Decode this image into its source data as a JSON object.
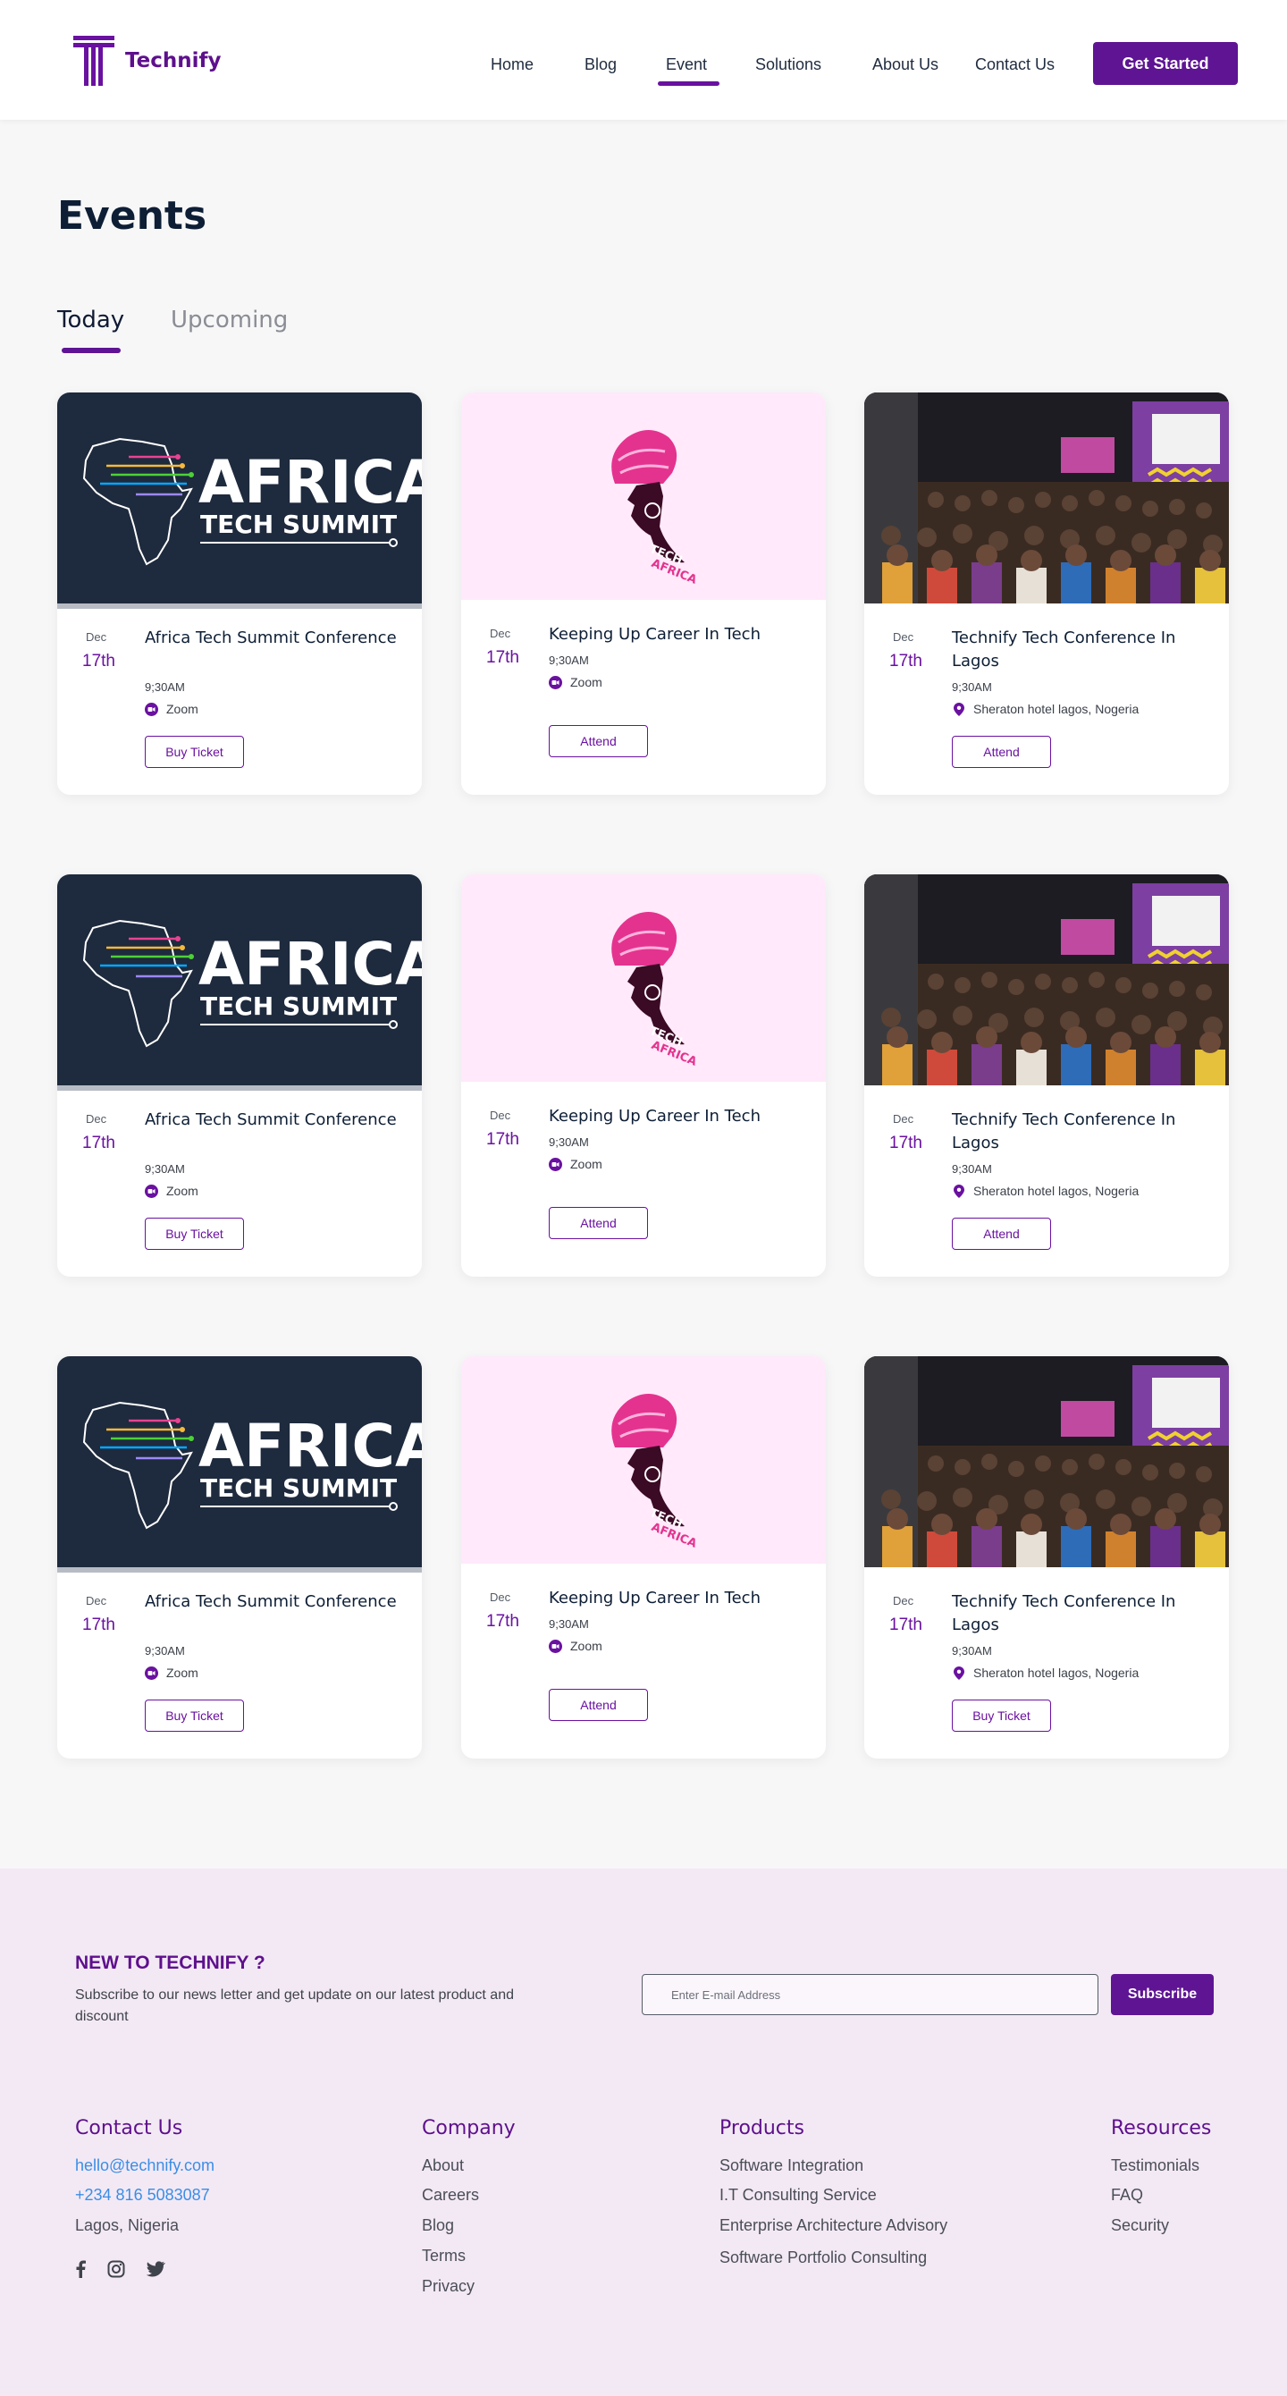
{
  "header": {
    "brand": "Technify",
    "nav": [
      {
        "label": "Home",
        "active": false
      },
      {
        "label": "Blog",
        "active": false
      },
      {
        "label": "Event",
        "active": true
      },
      {
        "label": "Solutions",
        "active": false
      },
      {
        "label": "About Us",
        "active": false
      },
      {
        "label": "Contact Us",
        "active": false
      }
    ],
    "cta_label": "Get Started"
  },
  "page": {
    "title": "Events",
    "tabs": [
      {
        "label": "Today",
        "active": true
      },
      {
        "label": "Upcoming",
        "active": false
      }
    ]
  },
  "banners": {
    "africa_main": "AFRICA",
    "africa_sub": "TECH SUMMIT",
    "pink_text1": "TECH",
    "pink_text2": "AFRICA"
  },
  "events": [
    {
      "month": "Dec",
      "day": "17th",
      "title": "Africa Tech Summit Conference",
      "time": "9;30AM",
      "location": "Zoom",
      "loc_icon": "video-icon",
      "button": "Buy Ticket",
      "image": "africa-tech-summit"
    },
    {
      "month": "Dec",
      "day": "17th",
      "title": "Keeping Up Career In Tech",
      "time": "9;30AM",
      "location": "Zoom",
      "loc_icon": "video-icon",
      "button": "Attend",
      "image": "tech-africa-woman"
    },
    {
      "month": "Dec",
      "day": "17th",
      "title": "Technify Tech Conference In Lagos",
      "time": "9;30AM",
      "location": "Sheraton hotel lagos, Nogeria",
      "loc_icon": "map-pin-icon",
      "button": "Attend",
      "image": "conference-crowd"
    },
    {
      "month": "Dec",
      "day": "17th",
      "title": "Africa Tech Summit Conference",
      "time": "9;30AM",
      "location": "Zoom",
      "loc_icon": "video-icon",
      "button": "Buy Ticket",
      "image": "africa-tech-summit"
    },
    {
      "month": "Dec",
      "day": "17th",
      "title": "Keeping Up Career In Tech",
      "time": "9;30AM",
      "location": "Zoom",
      "loc_icon": "video-icon",
      "button": "Attend",
      "image": "tech-africa-woman"
    },
    {
      "month": "Dec",
      "day": "17th",
      "title": "Technify Tech Conference In Lagos",
      "time": "9;30AM",
      "location": "Sheraton hotel lagos, Nogeria",
      "loc_icon": "map-pin-icon",
      "button": "Attend",
      "image": "conference-crowd"
    },
    {
      "month": "Dec",
      "day": "17th",
      "title": "Africa Tech Summit Conference",
      "time": "9;30AM",
      "location": "Zoom",
      "loc_icon": "video-icon",
      "button": "Buy Ticket",
      "image": "africa-tech-summit"
    },
    {
      "month": "Dec",
      "day": "17th",
      "title": "Keeping Up Career In Tech",
      "time": "9;30AM",
      "location": "Zoom",
      "loc_icon": "video-icon",
      "button": "Attend",
      "image": "tech-africa-woman"
    },
    {
      "month": "Dec",
      "day": "17th",
      "title": "Technify Tech Conference In Lagos",
      "time": "9;30AM",
      "location": "Sheraton hotel lagos, Nogeria",
      "loc_icon": "map-pin-icon",
      "button": "Buy Ticket",
      "image": "conference-crowd"
    }
  ],
  "newsletter": {
    "title": "NEW TO TECHNIFY ?",
    "text": "Subscribe to our news letter and get update on our latest product and discount",
    "placeholder": "Enter E-mail Address",
    "button": "Subscribe"
  },
  "footer": {
    "contact": {
      "heading": "Contact Us",
      "email": "hello@technify.com",
      "phone": "+234 816 5083087",
      "city": "Lagos, Nigeria",
      "social": [
        "facebook-icon",
        "instagram-icon",
        "twitter-icon"
      ]
    },
    "company": {
      "heading": "Company",
      "links": [
        "About",
        "Careers",
        "Blog",
        "Terms",
        "Privacy"
      ]
    },
    "products": {
      "heading": "Products",
      "links": [
        "Software Integration",
        "I.T Consulting Service",
        "Enterprise Architecture Advisory",
        "Software Portfolio Consulting"
      ]
    },
    "resources": {
      "heading": "Resources",
      "links": [
        "Testimonials",
        "FAQ",
        "Security"
      ]
    }
  },
  "colors": {
    "brand": "#5e1493",
    "link": "#3a8ee6",
    "footer_bg": "#f3e9f5",
    "pink_bg": "#ffe9fa",
    "navy": "#1e2a3d"
  }
}
